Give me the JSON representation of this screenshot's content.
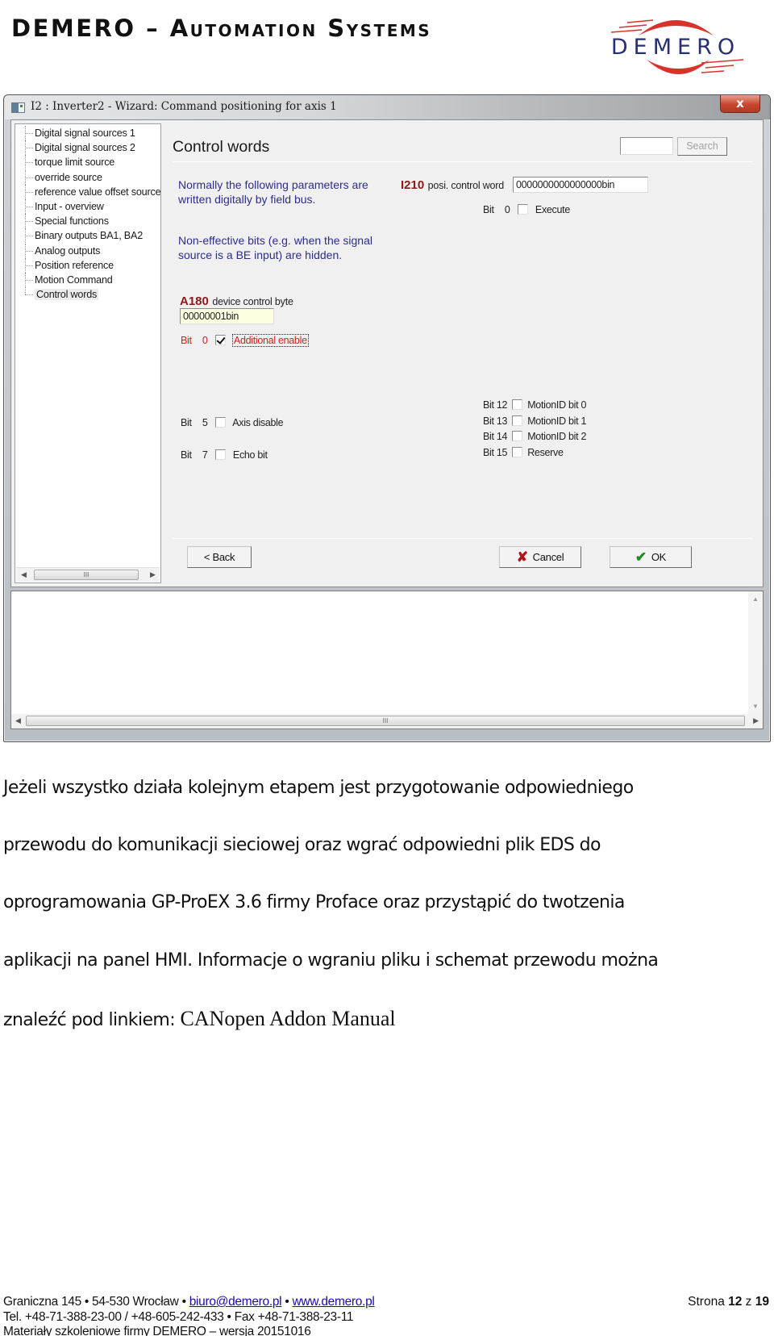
{
  "header": {
    "title": "DEMERO – Automation Systems",
    "logo_text": "DEMERO",
    "colors": {
      "logo_red": "#d9322b",
      "logo_blue": "#28306e"
    }
  },
  "window": {
    "title": "I2 : Inverter2 - Wizard: Command positioning for axis 1",
    "close_label": "x",
    "tree": {
      "items": [
        "Digital signal sources 1",
        "Digital signal sources 2",
        "torque limit source",
        "override source",
        "reference value offset source",
        "Input - overview",
        "Special functions",
        "Binary outputs BA1, BA2",
        "Analog outputs",
        "Position reference",
        "Motion Command",
        "Control words"
      ],
      "selected": "Control words",
      "scroll_thumb": "III"
    },
    "content": {
      "heading": "Control words",
      "search_input_value": "",
      "search_button": "Search",
      "info_1": [
        "Normally the following parameters are",
        "written digitally by field bus."
      ],
      "info_2": [
        "Non-effective bits (e.g. when the signal",
        "source is a BE input) are hidden."
      ],
      "i210": {
        "code": "I210",
        "label": "posi. control word",
        "value": "0000000000000000bin",
        "bits": [
          {
            "bit_label": "Bit",
            "bit": "0",
            "name": "Execute",
            "checked": false
          }
        ]
      },
      "a180": {
        "code": "A180",
        "label": "device control byte",
        "value": "00000001bin",
        "bits": [
          {
            "bit_label": "Bit",
            "bit": "0",
            "name": "Additional enable",
            "checked": true
          },
          {
            "bit_label": "Bit",
            "bit": "5",
            "name": "Axis disable",
            "checked": false
          },
          {
            "bit_label": "Bit",
            "bit": "7",
            "name": "Echo bit",
            "checked": false
          }
        ]
      },
      "i210_high_bits": [
        {
          "bit_label": "Bit",
          "bit": "12",
          "name": "MotionID bit 0",
          "checked": false
        },
        {
          "bit_label": "Bit",
          "bit": "13",
          "name": "MotionID bit 1",
          "checked": false
        },
        {
          "bit_label": "Bit",
          "bit": "14",
          "name": "MotionID bit 2",
          "checked": false
        },
        {
          "bit_label": "Bit",
          "bit": "15",
          "name": "Reserve",
          "checked": false
        }
      ],
      "buttons": {
        "back": "< Back",
        "cancel": "Cancel",
        "ok": "OK"
      }
    },
    "log_scroll_thumb": "III"
  },
  "body": {
    "lines": [
      "Jeżeli wszystko działa kolejnym etapem jest przygotowanie odpowiedniego",
      "przewodu do komunikacji sieciowej oraz wgrać odpowiedni plik EDS do",
      "oprogramowania GP-ProEX 3.6 firmy Proface oraz przystąpić do twotzenia",
      "aplikacji na panel HMI. Informacje o wgraniu pliku i schemat przewodu można"
    ],
    "last_line_prefix": "znaleźć pod linkiem: ",
    "link_text": "CANopen Addon Manual"
  },
  "footer": {
    "address": "Graniczna 145 • 54-530 Wrocław • ",
    "email": "biuro@demero.pl",
    "sep": " • ",
    "website": "www.demero.pl",
    "phones": "Tel. +48-71-388-23-00 / +48-605-242-433 • Fax +48-71-388-23-11",
    "materials": "Materiały szkoleniowe firmy DEMERO – wersja 20151016",
    "page_prefix": "Strona ",
    "page_current": "12",
    "page_sep": " z ",
    "page_total": "19"
  }
}
